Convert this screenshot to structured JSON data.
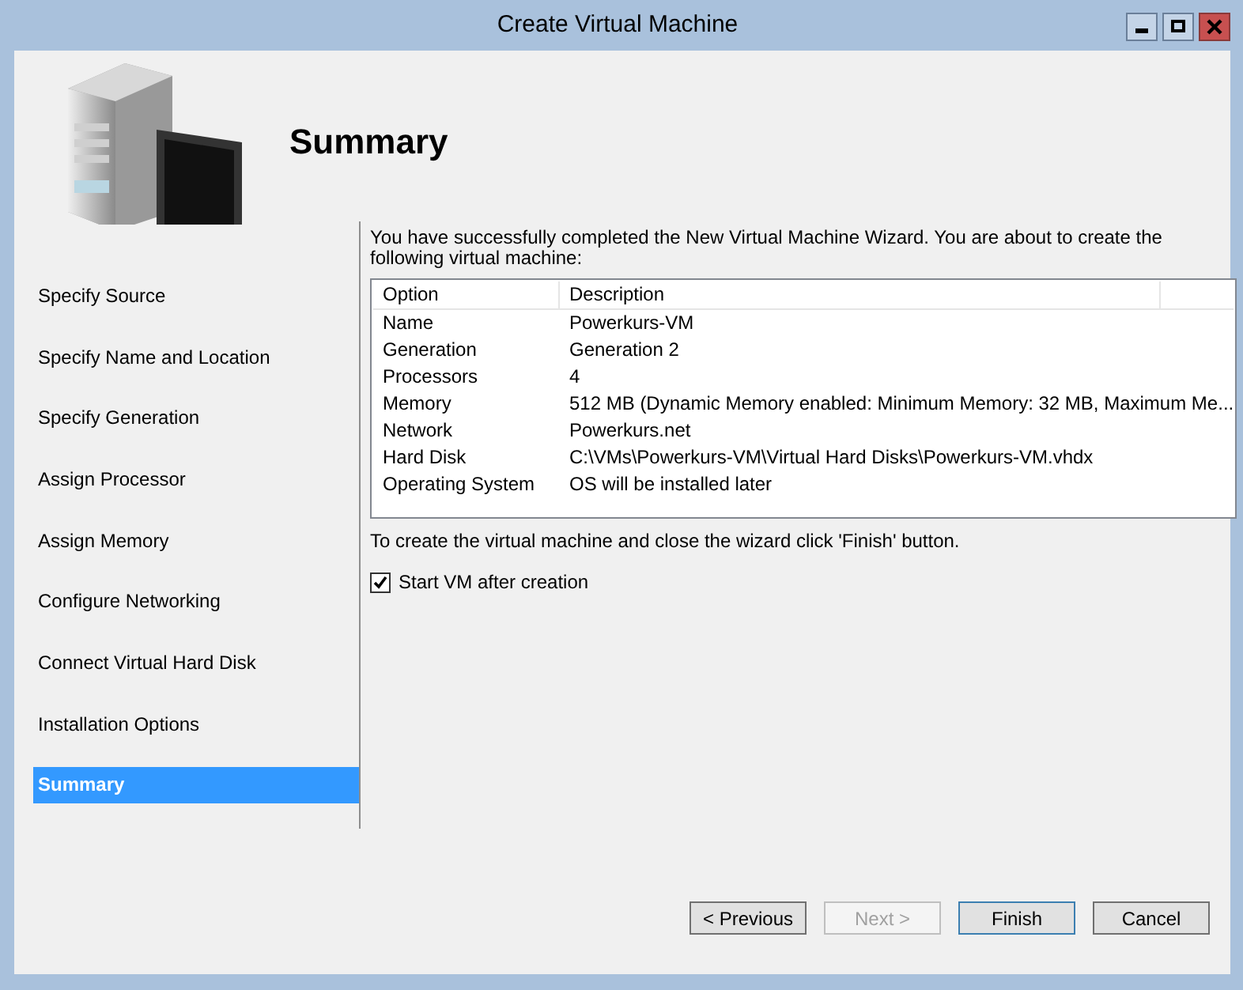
{
  "window": {
    "title": "Create Virtual Machine"
  },
  "page_title": "Summary",
  "steps": [
    {
      "label": "Specify Source",
      "selected": false
    },
    {
      "label": "Specify Name and Location",
      "selected": false
    },
    {
      "label": "Specify Generation",
      "selected": false
    },
    {
      "label": "Assign Processor",
      "selected": false
    },
    {
      "label": "Assign Memory",
      "selected": false
    },
    {
      "label": "Configure Networking",
      "selected": false
    },
    {
      "label": "Connect Virtual Hard Disk",
      "selected": false
    },
    {
      "label": "Installation Options",
      "selected": false
    },
    {
      "label": "Summary",
      "selected": true
    }
  ],
  "intro": "You have successfully completed the New Virtual Machine Wizard. You are about to create the following virtual machine:",
  "table": {
    "columns": [
      "Option",
      "Description"
    ],
    "rows": [
      [
        "Name",
        "Powerkurs-VM"
      ],
      [
        "Generation",
        "Generation 2"
      ],
      [
        "Processors",
        "4"
      ],
      [
        "Memory",
        "512 MB (Dynamic Memory enabled: Minimum Memory: 32 MB, Maximum Me..."
      ],
      [
        "Network",
        "Powerkurs.net"
      ],
      [
        "Hard Disk",
        "C:\\VMs\\Powerkurs-VM\\Virtual Hard Disks\\Powerkurs-VM.vhdx"
      ],
      [
        "Operating System",
        "OS will be installed later"
      ]
    ]
  },
  "finish_note": "To create the virtual machine and close the wizard click 'Finish' button.",
  "start_checkbox": {
    "label": "Start VM after creation",
    "checked": true
  },
  "buttons": [
    {
      "label": "< Previous",
      "disabled": false,
      "default": false
    },
    {
      "label": "Next >",
      "disabled": true,
      "default": false
    },
    {
      "label": "Finish",
      "disabled": false,
      "default": true
    },
    {
      "label": "Cancel",
      "disabled": false,
      "default": false
    }
  ]
}
